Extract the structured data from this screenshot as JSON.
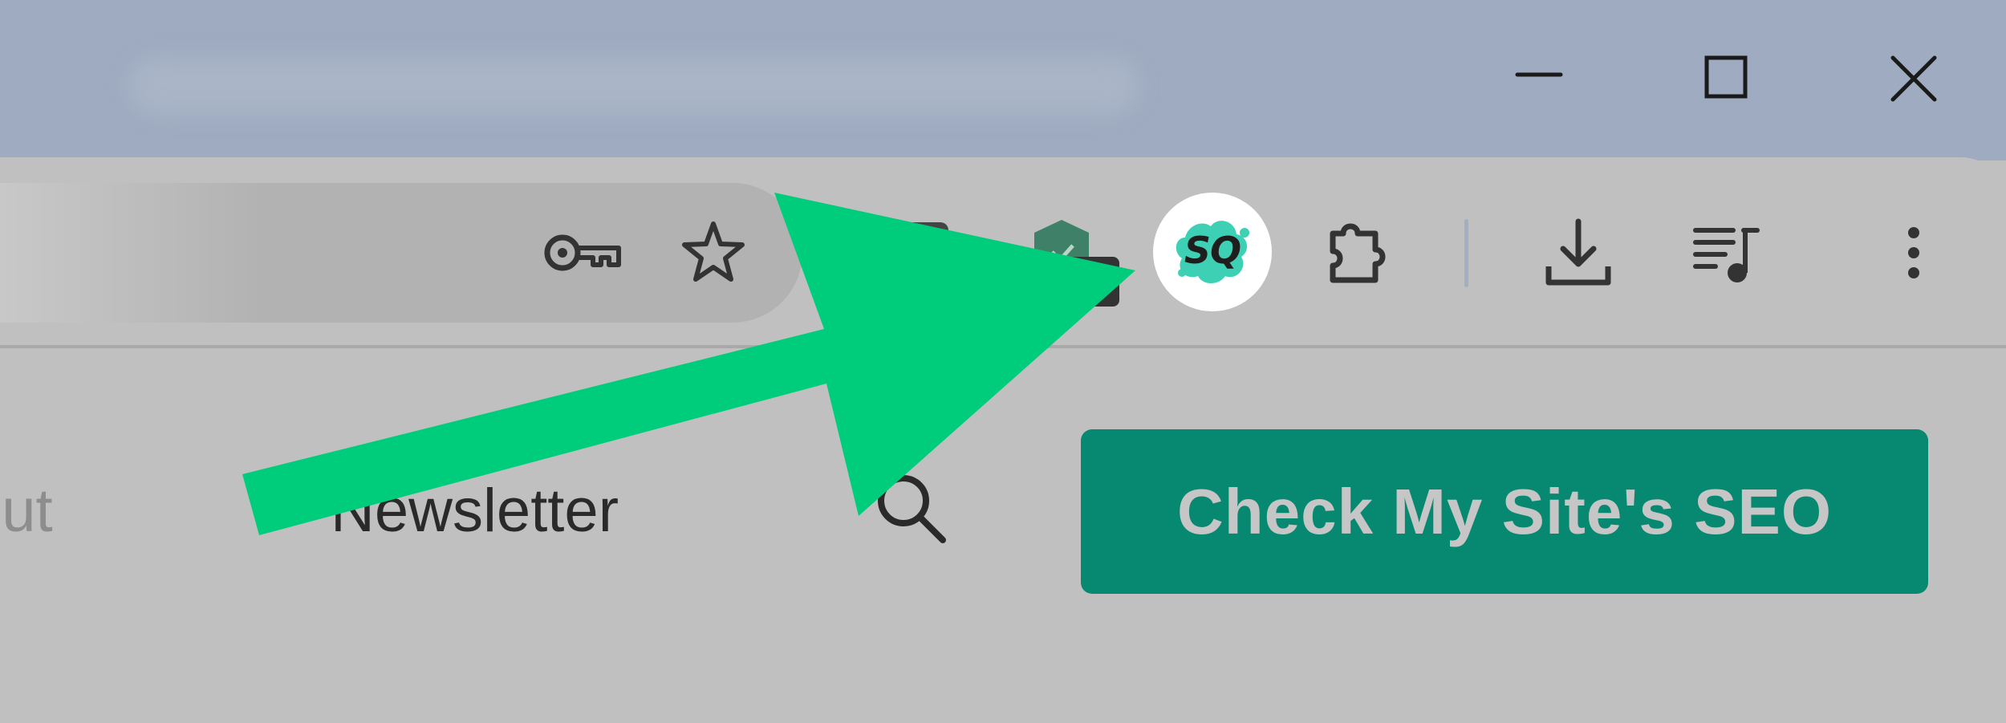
{
  "window_controls": {
    "icons": [
      "minimize-icon",
      "maximize-icon",
      "close-icon"
    ]
  },
  "toolbar": {
    "omnibox_icons": [
      "key-icon",
      "star-icon"
    ],
    "extensions": {
      "sq_label": "SQ",
      "sq_colors": {
        "badge_bg": "#ffffff",
        "splash": "#3ed0b5",
        "text": "#1e1e1e"
      },
      "icons": [
        "extension-dark-icon",
        "shield-extension-icon",
        "sq-extension-icon",
        "puzzle-icon"
      ]
    },
    "right_icons": [
      "download-icon",
      "media-queue-icon",
      "more-vert-icon"
    ]
  },
  "page": {
    "nav": {
      "about_fragment": "out",
      "newsletter": "Newsletter"
    },
    "search_icon": "search-icon",
    "cta_label": "Check My Site's SEO"
  },
  "colors": {
    "title_bar": "#9eabc0",
    "toolbar": "#c0c0c0",
    "omnibox": "#b2b2b2",
    "cta_bg": "#078870",
    "cta_text": "#c6c6c6",
    "arrow": "#00cd7c",
    "icon_dark": "#333333"
  }
}
